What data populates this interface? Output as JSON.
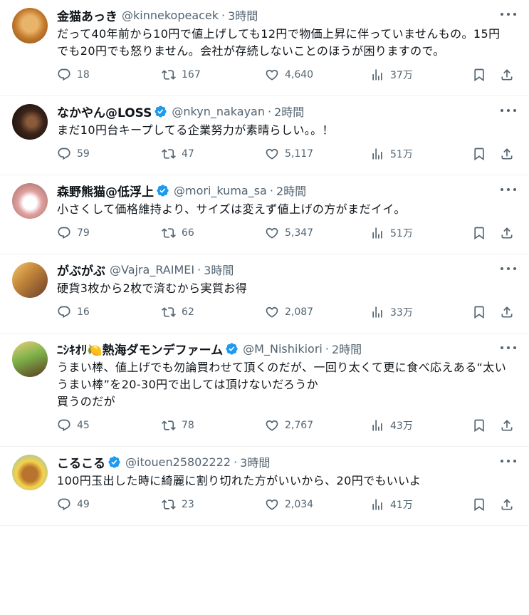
{
  "tweets": [
    {
      "name": "金猫あっき",
      "handle": "@kinnekopeacek",
      "time": "3時間",
      "verified": false,
      "text": "だって40年前から10円で値上げしても12円で物価上昇に伴っていませんもの。15円でも20円でも怒りません。会社が存続しないことのほうが困りますので。",
      "replies": "18",
      "retweets": "167",
      "likes": "4,640",
      "views": "37万"
    },
    {
      "name": "なかやん@LOSS",
      "handle": "@nkyn_nakayan",
      "time": "2時間",
      "verified": true,
      "text": "まだ10円台キープしてる企業努力が素晴らしい。。！",
      "replies": "59",
      "retweets": "47",
      "likes": "5,117",
      "views": "51万"
    },
    {
      "name": "森野熊猫@低浮上",
      "handle": "@mori_kuma_sa",
      "time": "2時間",
      "verified": true,
      "text": "小さくして価格維持より、サイズは変えず値上げの方がまだイイ。",
      "replies": "79",
      "retweets": "66",
      "likes": "5,347",
      "views": "51万"
    },
    {
      "name": "がぶがぶ",
      "handle": "@Vajra_RAIMEI",
      "time": "3時間",
      "verified": false,
      "text": "硬貨3枚から2枚で済むから実質お得",
      "replies": "16",
      "retweets": "62",
      "likes": "2,087",
      "views": "33万"
    },
    {
      "name": "ﾆｼｷｵﾘ🍋熱海ダモンデファーム",
      "handle": "@M_Nishikiori",
      "time": "2時間",
      "verified": true,
      "text": "うまい棒、値上げでも勿論買わせて頂くのだが、一回り太くて更に食べ応えある“太いうまい棒”を20-30円で出しては頂けないだろうか\n買うのだが",
      "replies": "45",
      "retweets": "78",
      "likes": "2,767",
      "views": "43万"
    },
    {
      "name": "こるこる",
      "handle": "@itouen25802222",
      "time": "3時間",
      "verified": true,
      "text": "100円玉出した時に綺麗に割り切れた方がいいから、20円でもいいよ",
      "replies": "49",
      "retweets": "23",
      "likes": "2,034",
      "views": "41万"
    }
  ],
  "separator": "·",
  "colors": {
    "text": "#0f1419",
    "muted": "#536471",
    "verified": "#1d9bf0",
    "divider": "#eff3f4"
  },
  "icons": {
    "reply": "reply-icon",
    "retweet": "retweet-icon",
    "like": "like-icon",
    "views": "views-icon",
    "bookmark": "bookmark-icon",
    "share": "share-icon",
    "more": "more-icon",
    "verified": "verified-badge-icon"
  }
}
